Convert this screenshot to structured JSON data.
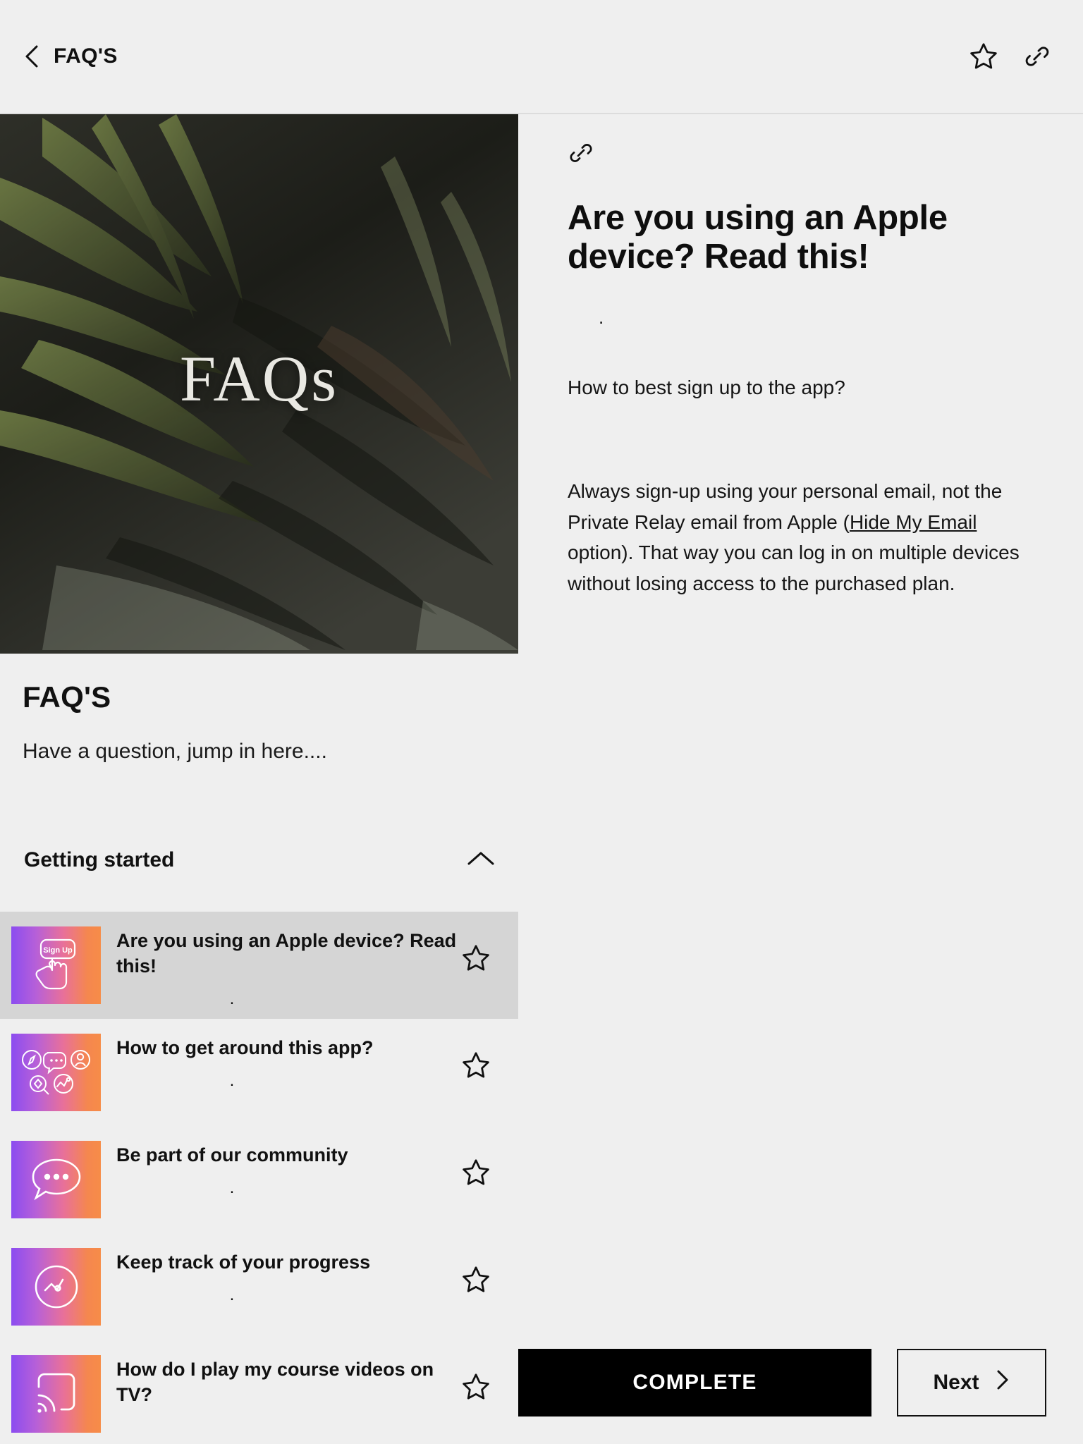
{
  "topbar": {
    "back_icon": "chevron-left-icon",
    "title": "FAQ'S",
    "star_icon": "star-outline-icon",
    "link_icon": "link-icon"
  },
  "left": {
    "hero_word": "FAQs",
    "title": "FAQ'S",
    "subtitle": "Have a question, jump in here....",
    "accordion": {
      "label": "Getting started",
      "chevron_icon": "chevron-up-icon",
      "expanded": true
    },
    "items": [
      {
        "title": "Are you using an Apple device? Read this!",
        "dot": ".",
        "thumb_icon": "sign-up-tap-icon",
        "thumb_label": "Sign Up",
        "star_icon": "star-outline-icon",
        "selected": true
      },
      {
        "title": "How to get around this app?",
        "dot": ".",
        "thumb_icon": "app-features-grid-icon",
        "star_icon": "star-outline-icon",
        "selected": false
      },
      {
        "title": "Be part of our community",
        "dot": ".",
        "thumb_icon": "chat-bubble-icon",
        "star_icon": "star-outline-icon",
        "selected": false
      },
      {
        "title": "Keep track of your progress",
        "dot": ".",
        "thumb_icon": "progress-chart-icon",
        "star_icon": "star-outline-icon",
        "selected": false
      },
      {
        "title": "How do I play my course videos on TV?",
        "dot": "",
        "thumb_icon": "cast-screen-icon",
        "star_icon": "star-outline-icon",
        "selected": false
      }
    ]
  },
  "article": {
    "link_icon": "link-icon",
    "title": "Are you using an Apple device? Read this!",
    "dot": ".",
    "question": "How to best sign up to the app?",
    "body_before_link": "Always sign-up using your personal email, not the Private Relay email from Apple (",
    "body_link": "Hide My Email",
    "body_after_link": " option). That way you can log in on multiple devices without losing access to the purchased plan."
  },
  "footer": {
    "complete_label": "COMPLETE",
    "next_label": "Next",
    "next_icon": "chevron-right-icon"
  },
  "colors": {
    "page_bg": "#efefef",
    "selected_row": "#d5d5d5",
    "primary_button": "#000000",
    "gradient_start": "#8b4cf0",
    "gradient_end": "#f68c48"
  }
}
